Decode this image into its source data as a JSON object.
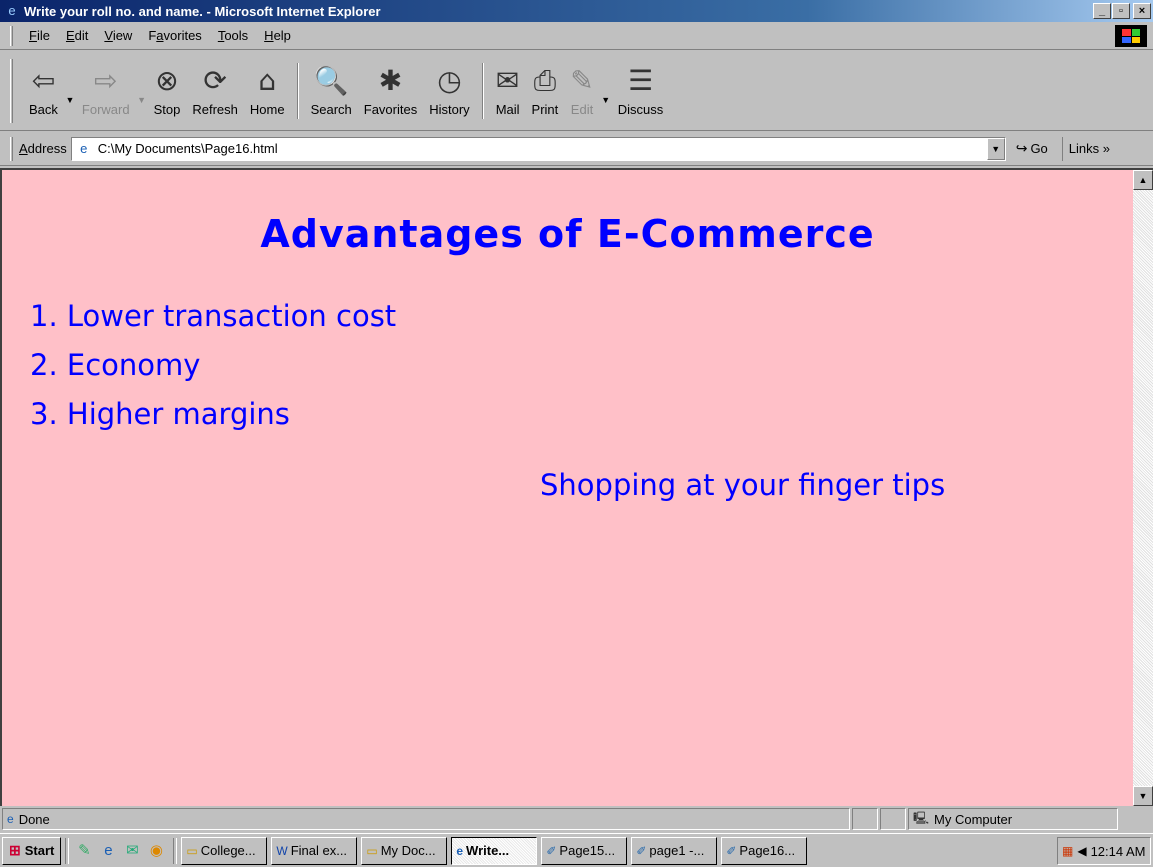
{
  "window": {
    "title": "Write your roll no. and name. - Microsoft Internet Explorer",
    "controls": {
      "minimize": "_",
      "maximize": "▫",
      "close": "×"
    }
  },
  "menu": [
    {
      "id": "file",
      "u": "F",
      "rest": "ile"
    },
    {
      "id": "edit",
      "u": "E",
      "rest": "dit"
    },
    {
      "id": "view",
      "u": "V",
      "rest": "iew"
    },
    {
      "id": "favorites",
      "pre": "F",
      "u": "a",
      "rest": "vorites"
    },
    {
      "id": "tools",
      "u": "T",
      "rest": "ools"
    },
    {
      "id": "help",
      "u": "H",
      "rest": "elp"
    }
  ],
  "toolbar": {
    "back": {
      "label": "Back",
      "icon": "back-arrow-icon",
      "glyph": "⇦"
    },
    "forward": {
      "label": "Forward",
      "icon": "forward-arrow-icon",
      "glyph": "⇨"
    },
    "stop": {
      "label": "Stop",
      "icon": "stop-icon",
      "glyph": "⊗"
    },
    "refresh": {
      "label": "Refresh",
      "icon": "refresh-icon",
      "glyph": "⟳"
    },
    "home": {
      "label": "Home",
      "icon": "home-icon",
      "glyph": "⌂"
    },
    "search": {
      "label": "Search",
      "icon": "search-icon",
      "glyph": "🔍"
    },
    "favorites": {
      "label": "Favorites",
      "icon": "favorites-icon",
      "glyph": "✱"
    },
    "history": {
      "label": "History",
      "icon": "history-icon",
      "glyph": "◷"
    },
    "mail": {
      "label": "Mail",
      "icon": "mail-icon",
      "glyph": "✉"
    },
    "print": {
      "label": "Print",
      "icon": "print-icon",
      "glyph": "⎙"
    },
    "edit": {
      "label": "Edit",
      "icon": "edit-icon",
      "glyph": "✎"
    },
    "discuss": {
      "label": "Discuss",
      "icon": "discuss-icon",
      "glyph": "☰"
    }
  },
  "address": {
    "label_u": "A",
    "label_rest": "ddress",
    "value": "C:\\My Documents\\Page16.html",
    "go_label": "Go",
    "links_label": "Links »"
  },
  "page": {
    "heading": "Advantages of E-Commerce",
    "items": [
      "1. Lower transaction cost",
      "2. Economy",
      "3. Higher margins"
    ],
    "tagline": "Shopping at your finger tips",
    "background": "#ffc0c8",
    "text_color": "#0000ff"
  },
  "status": {
    "text": "Done",
    "zone": "My Computer"
  },
  "taskbar": {
    "start_label": "Start",
    "tasks": [
      {
        "label": "College...",
        "icon": "folder-icon",
        "active": false
      },
      {
        "label": "Final ex...",
        "icon": "word-doc-icon",
        "active": false
      },
      {
        "label": "My Doc...",
        "icon": "folder-icon",
        "active": false
      },
      {
        "label": "Write...",
        "icon": "ie-icon",
        "active": true
      },
      {
        "label": "Page15...",
        "icon": "html-page-icon",
        "active": false
      },
      {
        "label": "page1 -...",
        "icon": "html-page-icon",
        "active": false
      },
      {
        "label": "Page16...",
        "icon": "html-page-icon",
        "active": false
      }
    ],
    "clock": "12:14 AM"
  }
}
